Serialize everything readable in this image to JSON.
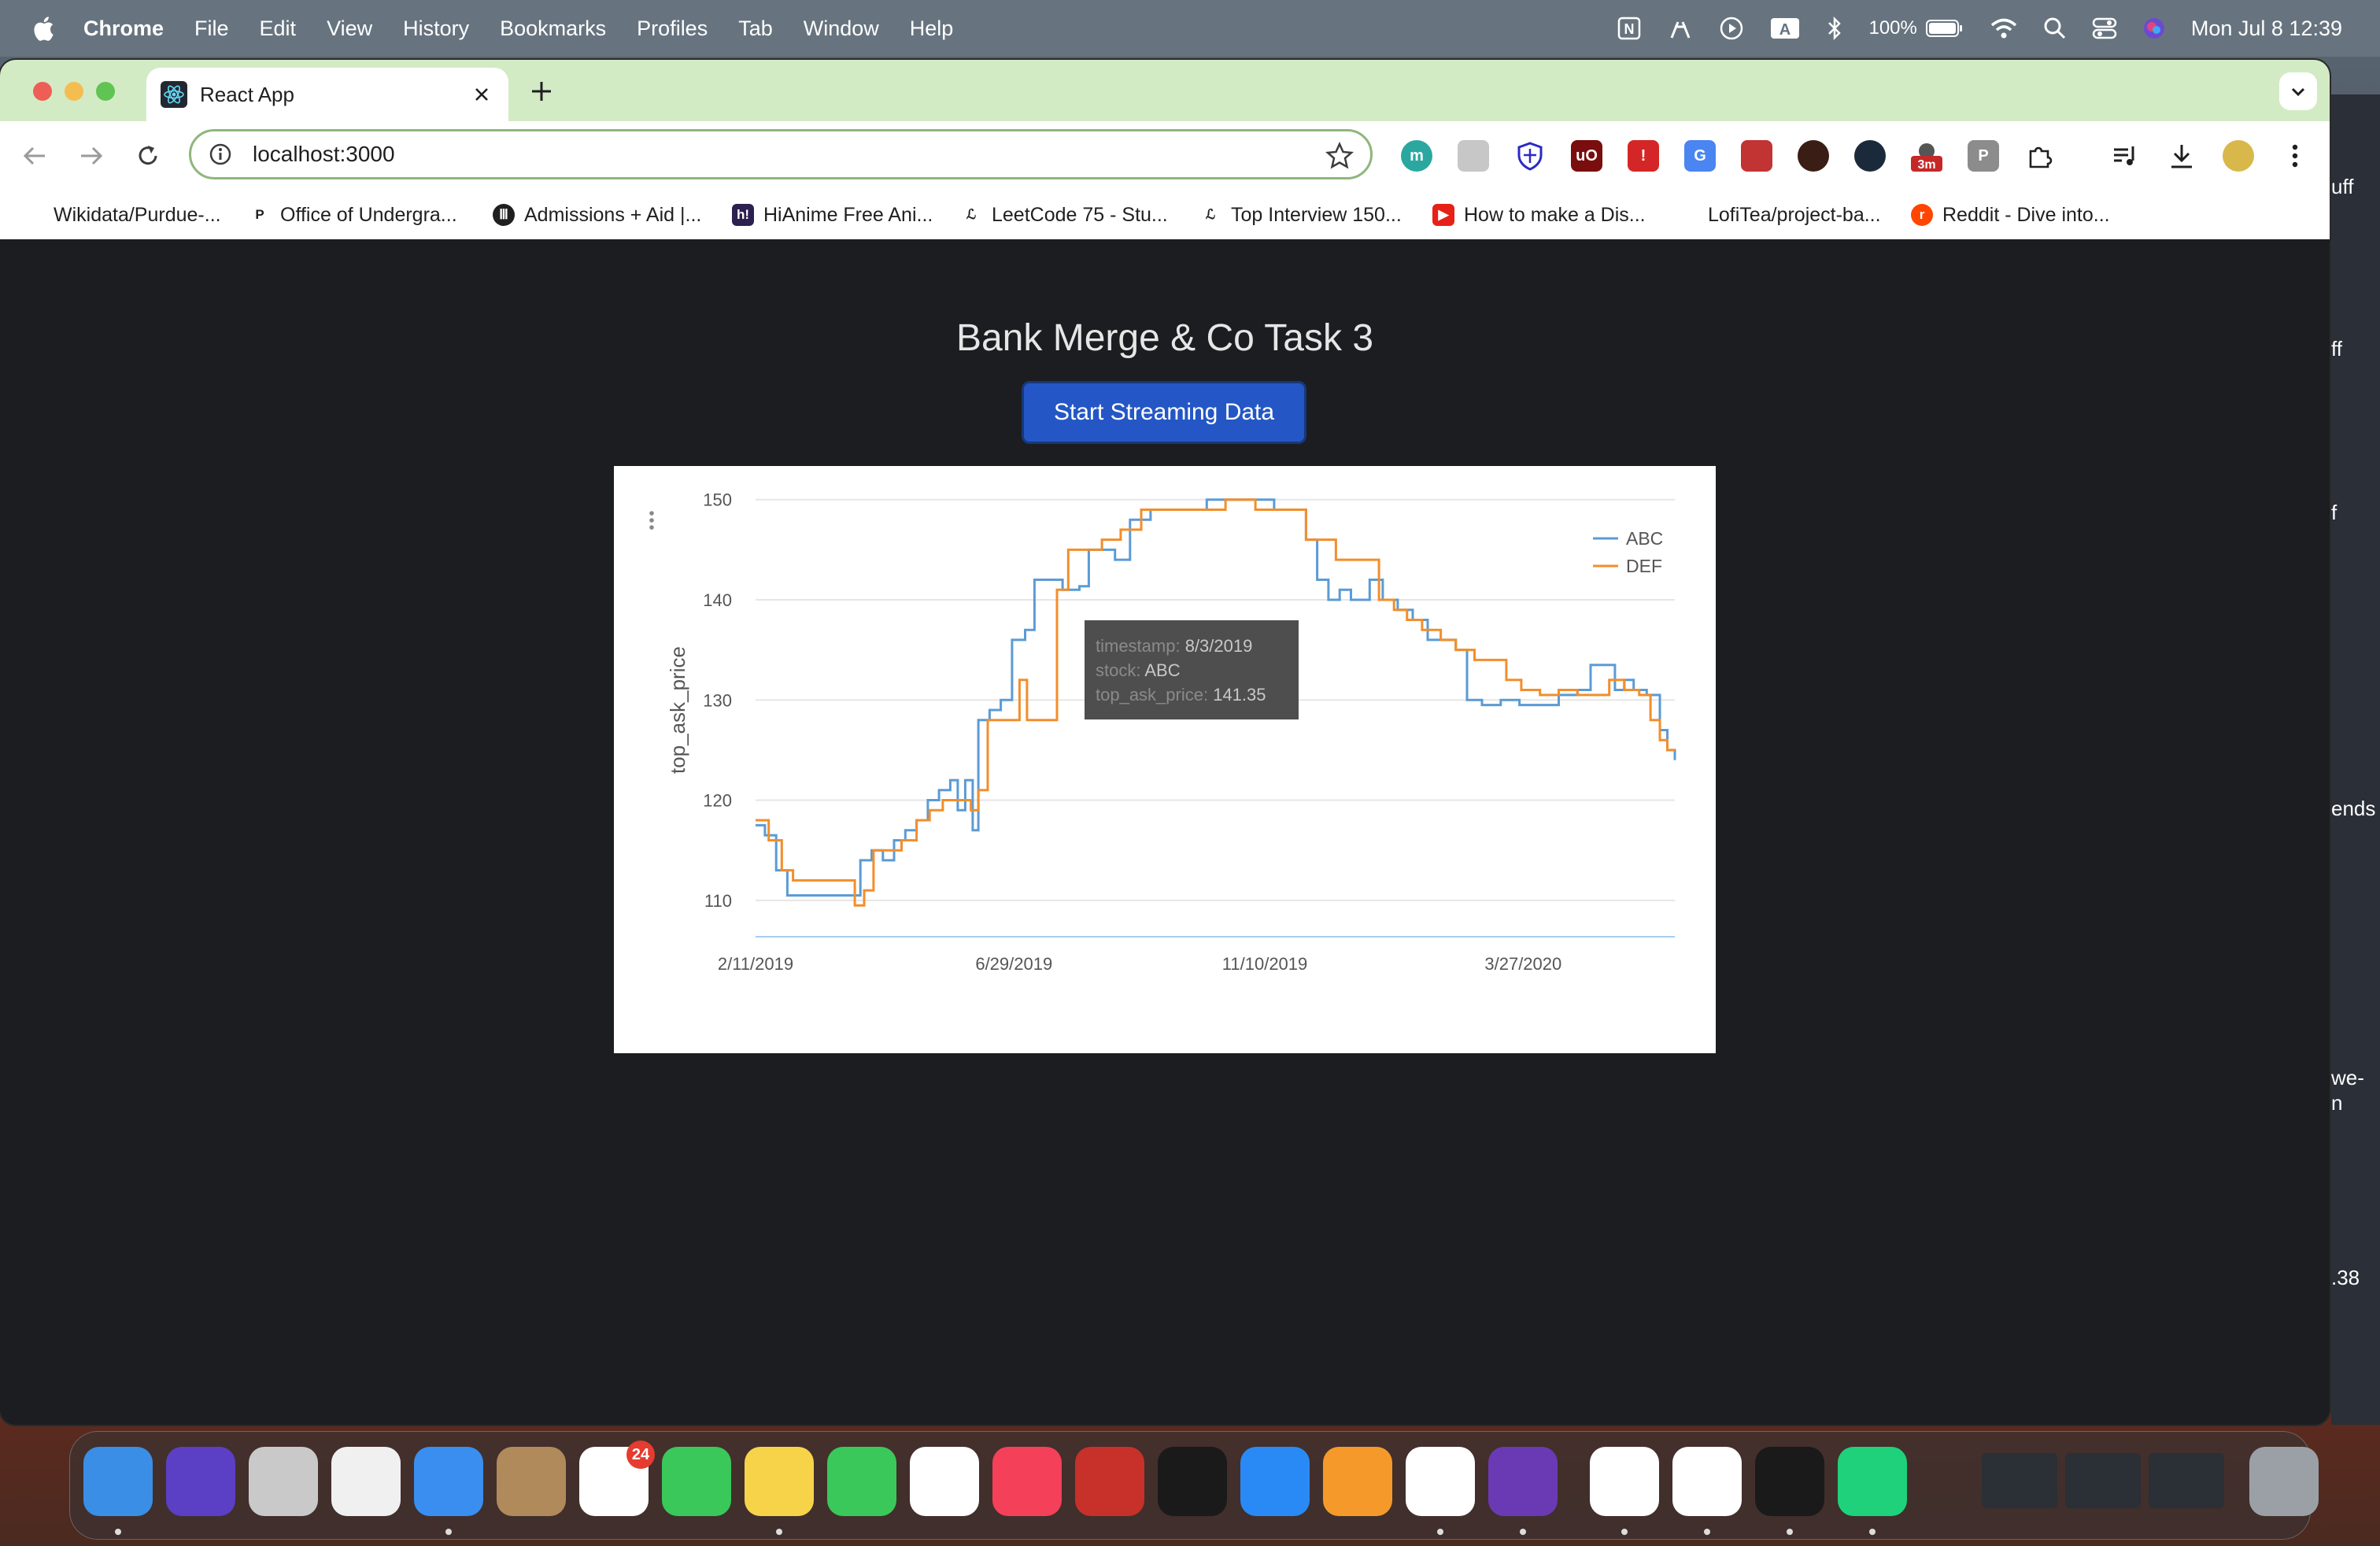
{
  "menubar": {
    "app_name": "Chrome",
    "items": [
      "File",
      "Edit",
      "View",
      "History",
      "Bookmarks",
      "Profiles",
      "Tab",
      "Window",
      "Help"
    ],
    "battery": "100%",
    "datetime": "Mon Jul 8  12:39"
  },
  "browser": {
    "tab_title": "React App",
    "url": "localhost:3000",
    "bookmarks": [
      "Wikidata/Purdue-...",
      "Office of Undergra...",
      "Admissions + Aid |...",
      "HiAnime Free Ani...",
      "LeetCode 75 - Stu...",
      "Top Interview 150...",
      "How to make a Dis...",
      "LofiTea/project-ba...",
      "Reddit - Dive into..."
    ],
    "extension_badge": "3m"
  },
  "page": {
    "title": "Bank Merge & Co Task 3",
    "button_label": "Start Streaming Data"
  },
  "tooltip": {
    "line1_label": "timestamp: ",
    "line1_value": "8/3/2019",
    "line2_label": "stock: ",
    "line2_value": "ABC",
    "line3_label": "top_ask_price: ",
    "line3_value": "141.35"
  },
  "colors": {
    "abc": "#5b9bd5",
    "def": "#f28e2b",
    "button": "#2457c5",
    "page_bg": "#1c1d20"
  },
  "chart_data": {
    "type": "line",
    "ylabel": "top_ask_price",
    "ylim": [
      107,
      151
    ],
    "yticks": [
      110,
      120,
      130,
      140,
      150
    ],
    "xticks": [
      "2/11/2019",
      "6/29/2019",
      "11/10/2019",
      "3/27/2020"
    ],
    "xlim": [
      "2019-02-11",
      "2020-06-16"
    ],
    "grid": true,
    "legend": "top-right",
    "series": [
      {
        "name": "ABC",
        "points": [
          [
            "2019-02-11",
            117.5
          ],
          [
            "2019-02-16",
            116.5
          ],
          [
            "2019-02-22",
            113
          ],
          [
            "2019-02-28",
            110.5
          ],
          [
            "2019-03-10",
            110.5
          ],
          [
            "2019-03-25",
            110.5
          ],
          [
            "2019-04-02",
            110.5
          ],
          [
            "2019-04-08",
            114
          ],
          [
            "2019-04-14",
            115
          ],
          [
            "2019-04-20",
            114
          ],
          [
            "2019-04-26",
            116
          ],
          [
            "2019-05-02",
            117
          ],
          [
            "2019-05-08",
            118
          ],
          [
            "2019-05-14",
            120
          ],
          [
            "2019-05-20",
            121
          ],
          [
            "2019-05-26",
            122
          ],
          [
            "2019-05-30",
            119
          ],
          [
            "2019-06-03",
            122
          ],
          [
            "2019-06-07",
            117
          ],
          [
            "2019-06-10",
            128
          ],
          [
            "2019-06-16",
            129
          ],
          [
            "2019-06-22",
            130
          ],
          [
            "2019-06-28",
            136
          ],
          [
            "2019-07-05",
            137
          ],
          [
            "2019-07-10",
            142
          ],
          [
            "2019-07-18",
            142
          ],
          [
            "2019-07-25",
            141
          ],
          [
            "2019-08-03",
            141.35
          ],
          [
            "2019-08-08",
            145
          ],
          [
            "2019-08-15",
            145
          ],
          [
            "2019-08-22",
            144
          ],
          [
            "2019-08-30",
            148
          ],
          [
            "2019-09-10",
            149
          ],
          [
            "2019-09-25",
            149
          ],
          [
            "2019-10-10",
            150
          ],
          [
            "2019-10-25",
            150
          ],
          [
            "2019-11-05",
            150
          ],
          [
            "2019-11-15",
            149
          ],
          [
            "2019-11-25",
            149
          ],
          [
            "2019-12-02",
            146
          ],
          [
            "2019-12-08",
            142
          ],
          [
            "2019-12-14",
            140
          ],
          [
            "2019-12-20",
            141
          ],
          [
            "2019-12-26",
            140
          ],
          [
            "2020-01-05",
            142
          ],
          [
            "2020-01-12",
            140
          ],
          [
            "2020-01-20",
            139
          ],
          [
            "2020-01-28",
            138
          ],
          [
            "2020-02-05",
            136
          ],
          [
            "2020-02-12",
            136
          ],
          [
            "2020-02-20",
            135
          ],
          [
            "2020-02-26",
            130
          ],
          [
            "2020-03-05",
            129.5
          ],
          [
            "2020-03-15",
            130
          ],
          [
            "2020-03-25",
            129.5
          ],
          [
            "2020-04-05",
            129.5
          ],
          [
            "2020-04-15",
            130.5
          ],
          [
            "2020-04-25",
            131
          ],
          [
            "2020-05-02",
            133.5
          ],
          [
            "2020-05-10",
            133.5
          ],
          [
            "2020-05-15",
            131
          ],
          [
            "2020-05-20",
            132
          ],
          [
            "2020-05-25",
            131
          ],
          [
            "2020-06-01",
            130.5
          ],
          [
            "2020-06-08",
            127
          ],
          [
            "2020-06-12",
            125
          ],
          [
            "2020-06-16",
            124
          ]
        ]
      },
      {
        "name": "DEF",
        "points": [
          [
            "2019-02-11",
            118
          ],
          [
            "2019-02-18",
            116
          ],
          [
            "2019-02-25",
            113
          ],
          [
            "2019-03-03",
            112
          ],
          [
            "2019-03-15",
            112
          ],
          [
            "2019-03-28",
            112
          ],
          [
            "2019-04-05",
            109.5
          ],
          [
            "2019-04-10",
            111
          ],
          [
            "2019-04-15",
            115
          ],
          [
            "2019-04-22",
            115
          ],
          [
            "2019-04-30",
            116
          ],
          [
            "2019-05-08",
            118
          ],
          [
            "2019-05-15",
            119
          ],
          [
            "2019-05-22",
            120
          ],
          [
            "2019-05-28",
            120
          ],
          [
            "2019-06-02",
            120
          ],
          [
            "2019-06-06",
            119
          ],
          [
            "2019-06-10",
            121
          ],
          [
            "2019-06-15",
            128
          ],
          [
            "2019-06-25",
            128
          ],
          [
            "2019-07-02",
            132
          ],
          [
            "2019-07-06",
            128
          ],
          [
            "2019-07-15",
            128
          ],
          [
            "2019-07-22",
            141
          ],
          [
            "2019-07-28",
            145
          ],
          [
            "2019-08-05",
            145
          ],
          [
            "2019-08-15",
            146
          ],
          [
            "2019-08-25",
            147
          ],
          [
            "2019-09-05",
            149
          ],
          [
            "2019-09-20",
            149
          ],
          [
            "2019-10-05",
            149
          ],
          [
            "2019-10-20",
            150
          ],
          [
            "2019-11-05",
            149
          ],
          [
            "2019-11-15",
            149
          ],
          [
            "2019-11-25",
            149
          ],
          [
            "2019-12-02",
            146
          ],
          [
            "2019-12-10",
            146
          ],
          [
            "2019-12-18",
            144
          ],
          [
            "2019-12-25",
            144
          ],
          [
            "2020-01-02",
            144
          ],
          [
            "2020-01-10",
            140
          ],
          [
            "2020-01-18",
            139
          ],
          [
            "2020-01-25",
            138
          ],
          [
            "2020-02-02",
            137
          ],
          [
            "2020-02-12",
            136
          ],
          [
            "2020-02-20",
            135
          ],
          [
            "2020-03-01",
            134
          ],
          [
            "2020-03-10",
            134
          ],
          [
            "2020-03-18",
            132
          ],
          [
            "2020-03-26",
            131
          ],
          [
            "2020-04-05",
            130.5
          ],
          [
            "2020-04-15",
            131
          ],
          [
            "2020-04-25",
            130.5
          ],
          [
            "2020-05-05",
            130.5
          ],
          [
            "2020-05-12",
            132
          ],
          [
            "2020-05-20",
            131
          ],
          [
            "2020-05-28",
            130.5
          ],
          [
            "2020-06-03",
            128
          ],
          [
            "2020-06-08",
            126
          ],
          [
            "2020-06-12",
            125
          ],
          [
            "2020-06-16",
            125
          ]
        ]
      }
    ]
  },
  "dock": {
    "reminders_badge": "24",
    "apps": [
      "finder-icon",
      "siri-icon",
      "launchpad-icon",
      "screen-icon",
      "mail-icon",
      "contacts-icon",
      "reminders-icon",
      "facetime-icon",
      "notes-icon",
      "messages-icon",
      "photos-icon",
      "music-icon",
      "photo-booth-icon",
      "tv-icon",
      "app-store-icon",
      "books-icon",
      "chrome-icon",
      "firefox-icon",
      "notion-icon",
      "vscode-icon",
      "terminal-icon",
      "pycharm-icon",
      "trash-icon"
    ]
  },
  "right_window_fragments": [
    "uff",
    "ff",
    "f",
    "ends",
    "we-",
    "n",
    ".38"
  ]
}
